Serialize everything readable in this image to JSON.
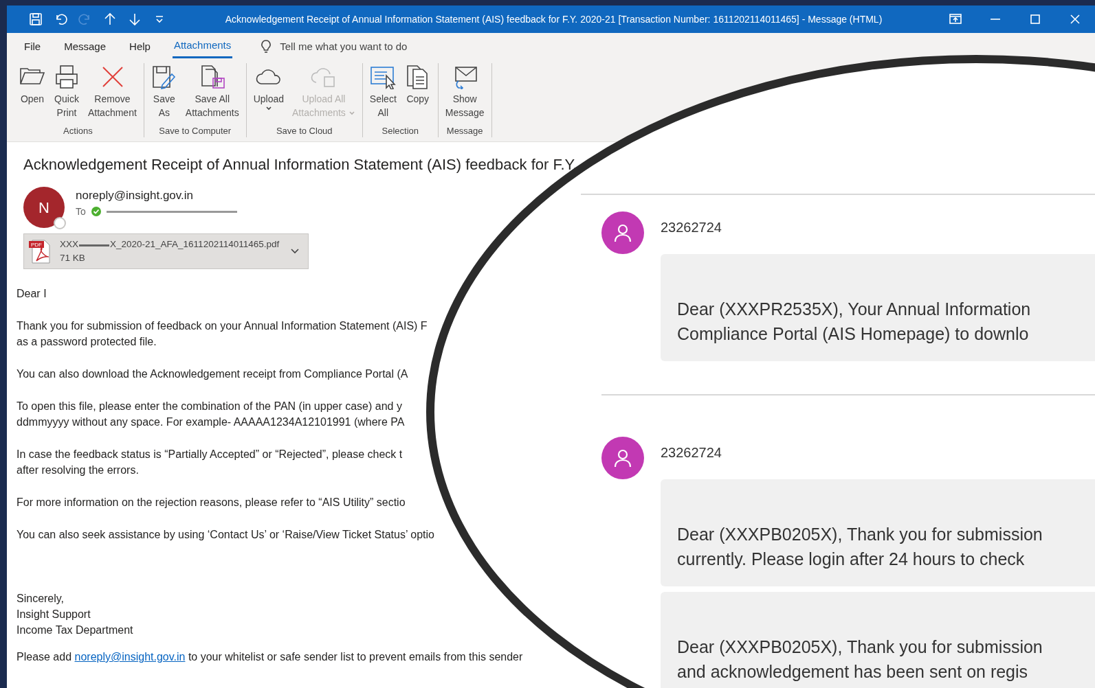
{
  "window": {
    "title": "Acknowledgement Receipt of Annual Information Statement (AIS) feedback for F.Y. 2020-21 [Transaction Number: 1611202114011465]  -  Message (HTML)"
  },
  "quick_access": [
    {
      "disabled": false
    },
    {
      "disabled": false
    },
    {
      "disabled": true
    },
    {
      "disabled": false
    },
    {
      "disabled": false
    },
    {
      "disabled": false
    }
  ],
  "tabs": [
    {
      "label": "File",
      "selected": false
    },
    {
      "label": "Message",
      "selected": false
    },
    {
      "label": "Help",
      "selected": false
    },
    {
      "label": "Attachments",
      "selected": true
    }
  ],
  "tell_me": {
    "placeholder": "Tell me what you want to do"
  },
  "ribbon_groups": [
    {
      "name": "Actions",
      "buttons": [
        {
          "lines": [
            "Open"
          ],
          "disabled": false,
          "dropdown": false
        },
        {
          "lines": [
            "Quick",
            "Print"
          ],
          "disabled": false,
          "dropdown": false
        },
        {
          "lines": [
            "Remove",
            "Attachment"
          ],
          "disabled": false,
          "dropdown": false
        }
      ]
    },
    {
      "name": "Save to Computer",
      "buttons": [
        {
          "lines": [
            "Save",
            "As"
          ],
          "disabled": false,
          "dropdown": false
        },
        {
          "lines": [
            "Save All",
            "Attachments"
          ],
          "disabled": false,
          "dropdown": false
        }
      ]
    },
    {
      "name": "Save to Cloud",
      "buttons": [
        {
          "lines": [
            "Upload"
          ],
          "disabled": false,
          "dropdown": true
        },
        {
          "lines": [
            "Upload All",
            "Attachments"
          ],
          "disabled": true,
          "dropdown": true
        }
      ]
    },
    {
      "name": "Selection",
      "buttons": [
        {
          "lines": [
            "Select",
            "All"
          ],
          "disabled": false,
          "dropdown": false
        },
        {
          "lines": [
            "Copy"
          ],
          "disabled": false,
          "dropdown": false
        }
      ]
    },
    {
      "name": "Message",
      "buttons": [
        {
          "lines": [
            "Show",
            "Message"
          ],
          "disabled": false,
          "dropdown": false
        }
      ]
    }
  ],
  "message": {
    "subject": "Acknowledgement Receipt of Annual Information Statement (AIS) feedback for F.Y.",
    "sender_initial": "N",
    "sender": "noreply@insight.gov.in",
    "to_label": "To",
    "attachment": {
      "type_badge": "PDF",
      "name_start": "XXX",
      "name_end": "X_2020-21_AFA_1611202114011465.pdf",
      "size": "71 KB"
    },
    "body": [
      [
        "Dear I"
      ],
      [
        "Thank you for submission of feedback on your Annual Information Statement (AIS) F",
        "as a password protected file."
      ],
      [
        "You can also download the Acknowledgement receipt from Compliance Portal (A"
      ],
      [
        "To open this file, please enter the combination of the PAN (in upper case) and y",
        "ddmmyyyy without any space. For example- AAAAA1234A12101991 (where PA"
      ],
      [
        "In case the feedback status is “Partially Accepted” or “Rejected”, please check t",
        "after resolving the errors."
      ],
      [
        "For more information on the rejection reasons, please refer to “AIS Utility” sectio"
      ],
      [
        "You can also seek assistance by using ‘Contact Us’ or ‘Raise/View Ticket Status’ optio"
      ]
    ],
    "signature": [
      "Sincerely,",
      "Insight Support",
      "Income Tax Department"
    ],
    "footer": {
      "before": "Please add ",
      "link": "noreply@insight.gov.in",
      "after": " to your whitelist or safe sender list to prevent emails from this sender"
    }
  },
  "sms_overlay": {
    "threads": [
      {
        "sender": "23262724",
        "bubbles": [
          [
            "Dear (XXXPR2535X), Your Annual Information",
            "Compliance Portal (AIS Homepage) to downlo"
          ]
        ]
      },
      {
        "sender": "23262724",
        "bubbles": [
          [
            "Dear (XXXPB0205X), Thank you for submission",
            "currently. Please login after 24 hours to check"
          ],
          [
            "Dear (XXXPB0205X), Thank you for submission",
            "and acknowledgement has been sent on regis"
          ]
        ]
      }
    ]
  }
}
